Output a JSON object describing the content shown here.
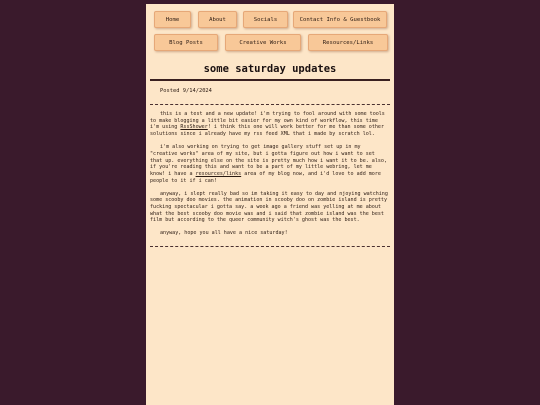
{
  "nav": {
    "home": "Home",
    "about": "About",
    "socials": "Socials",
    "contact": "Contact Info & Guestbook",
    "blog": "Blog Posts",
    "creative": "Creative Works",
    "resources": "Resources/Links"
  },
  "post": {
    "title": "some saturday updates",
    "posted": "Posted 9/14/2024",
    "p1a": "this is a test and a new update! i'm trying to fool around with some tools to make blogging a little bit easier for my own kind of workflow, this time i'm using ",
    "p1_link": "RssShower",
    "p1b": "! i think this one will work better for me than some other solutions since i already have my rss feed XML that i made by scratch lol.",
    "p2a": "i'm also working on trying to get image gallery stuff set up in my \"creative works\" area of my site, but i gotta figure out how i want to set that up. everything else on the site is pretty much how i want it to be. also, if you're reading this and want to be a part of my little webring, let me know! i have a ",
    "p2_link": "resources/links",
    "p2b": " area of my blog now, and i'd love to add more people to it if i can!",
    "p3": "anyway, i slept really bad so im taking it easy to day and njoying watching some scooby doo movies. the animation in scooby doo on zombie island is pretty fucking spectacular i gotta say. a week ago a friend was yelling at me about what the best scooby doo movie was and i said that zombie island was the best film but according to the queer community witch's ghost was the best.",
    "p4": "anyway, hope you all have a nice saturday!"
  }
}
